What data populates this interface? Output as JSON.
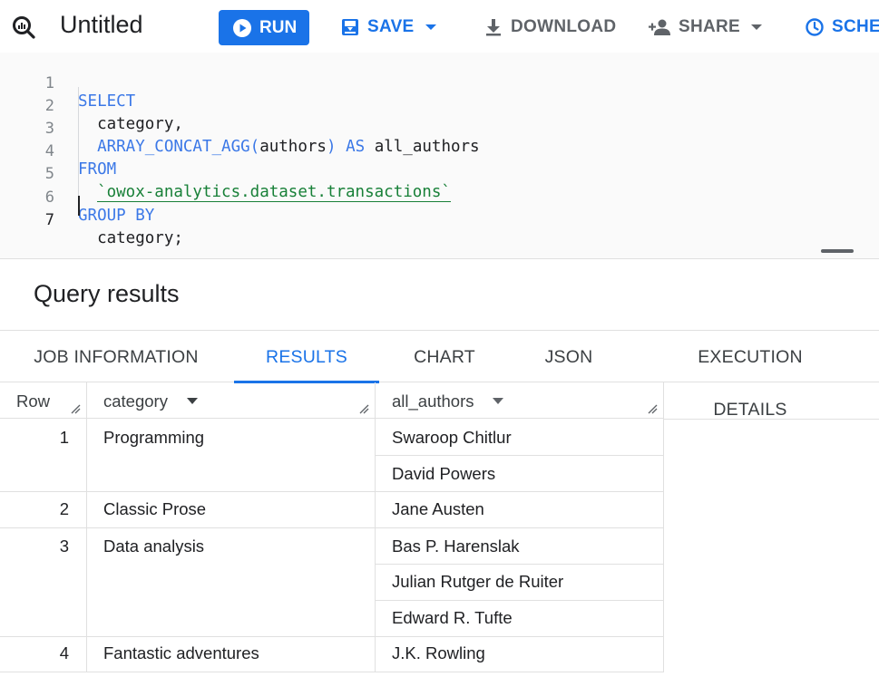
{
  "toolbar": {
    "title": "Untitled",
    "run_label": "RUN",
    "save_label": "SAVE",
    "download_label": "DOWNLOAD",
    "share_label": "SHARE",
    "schedule_label": "SCHE",
    "accent_color": "#1a73e8"
  },
  "editor": {
    "line_numbers": [
      "1",
      "2",
      "3",
      "4",
      "5",
      "6",
      "7"
    ],
    "kw_select": "SELECT",
    "col_category": "category,",
    "fn_array": "ARRAY_CONCAT_AGG(",
    "arg_authors": "authors",
    "fn_close": ")",
    "kw_as": "AS",
    "alias": "all_authors",
    "kw_from": "FROM",
    "table_ref": "`owox-analytics.dataset.transactions`",
    "kw_group_by": "GROUP BY",
    "group_col": "category;"
  },
  "results": {
    "title": "Query results",
    "tabs": [
      "JOB INFORMATION",
      "RESULTS",
      "CHART",
      "JSON",
      "EXECUTION DETAILS"
    ],
    "active_tab": "RESULTS",
    "columns": [
      "Row",
      "category",
      "all_authors"
    ],
    "rows": [
      {
        "row": "1",
        "category": "Programming",
        "authors": [
          "Swaroop Chitlur",
          "David Powers"
        ]
      },
      {
        "row": "2",
        "category": "Classic Prose",
        "authors": [
          "Jane Austen"
        ]
      },
      {
        "row": "3",
        "category": "Data analysis",
        "authors": [
          "Bas P. Harenslak",
          "Julian Rutger de Ruiter",
          "Edward R. Tufte"
        ]
      },
      {
        "row": "4",
        "category": "Fantastic adventures",
        "authors": [
          "J.K. Rowling"
        ]
      }
    ]
  }
}
